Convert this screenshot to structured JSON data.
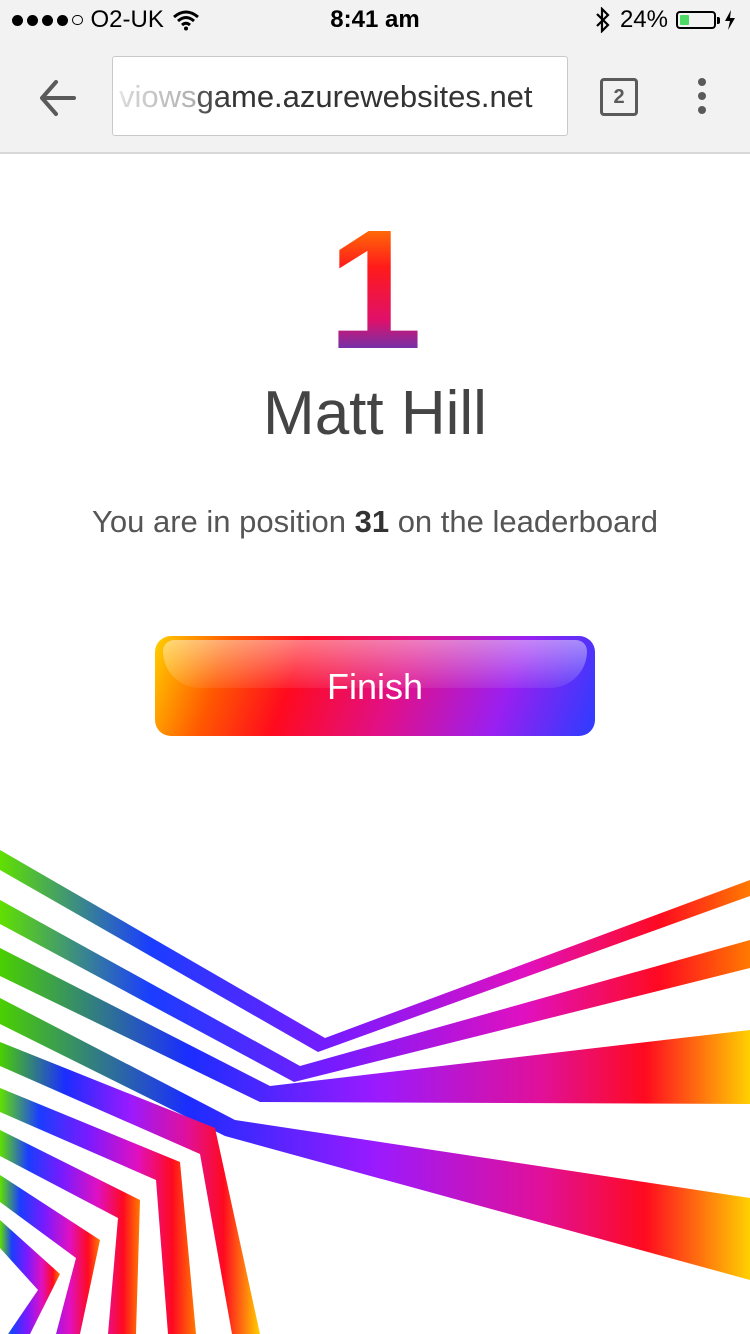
{
  "status_bar": {
    "carrier": "O2-UK",
    "time": "8:41 am",
    "battery": "24%",
    "battery_level": 0.24
  },
  "browser": {
    "url_faded": "viows",
    "url_main": "game.azurewebsites.net",
    "tab_count": "2"
  },
  "result": {
    "rank": "1",
    "name": "Matt Hill",
    "msg_before": "You are in position ",
    "position": "31",
    "msg_after": " on the leaderboard"
  },
  "actions": {
    "finish_label": "Finish"
  },
  "colors": {
    "accent_start": "#ffd000",
    "accent_mid": "#ff0a1e",
    "accent_end": "#2b3dff"
  }
}
